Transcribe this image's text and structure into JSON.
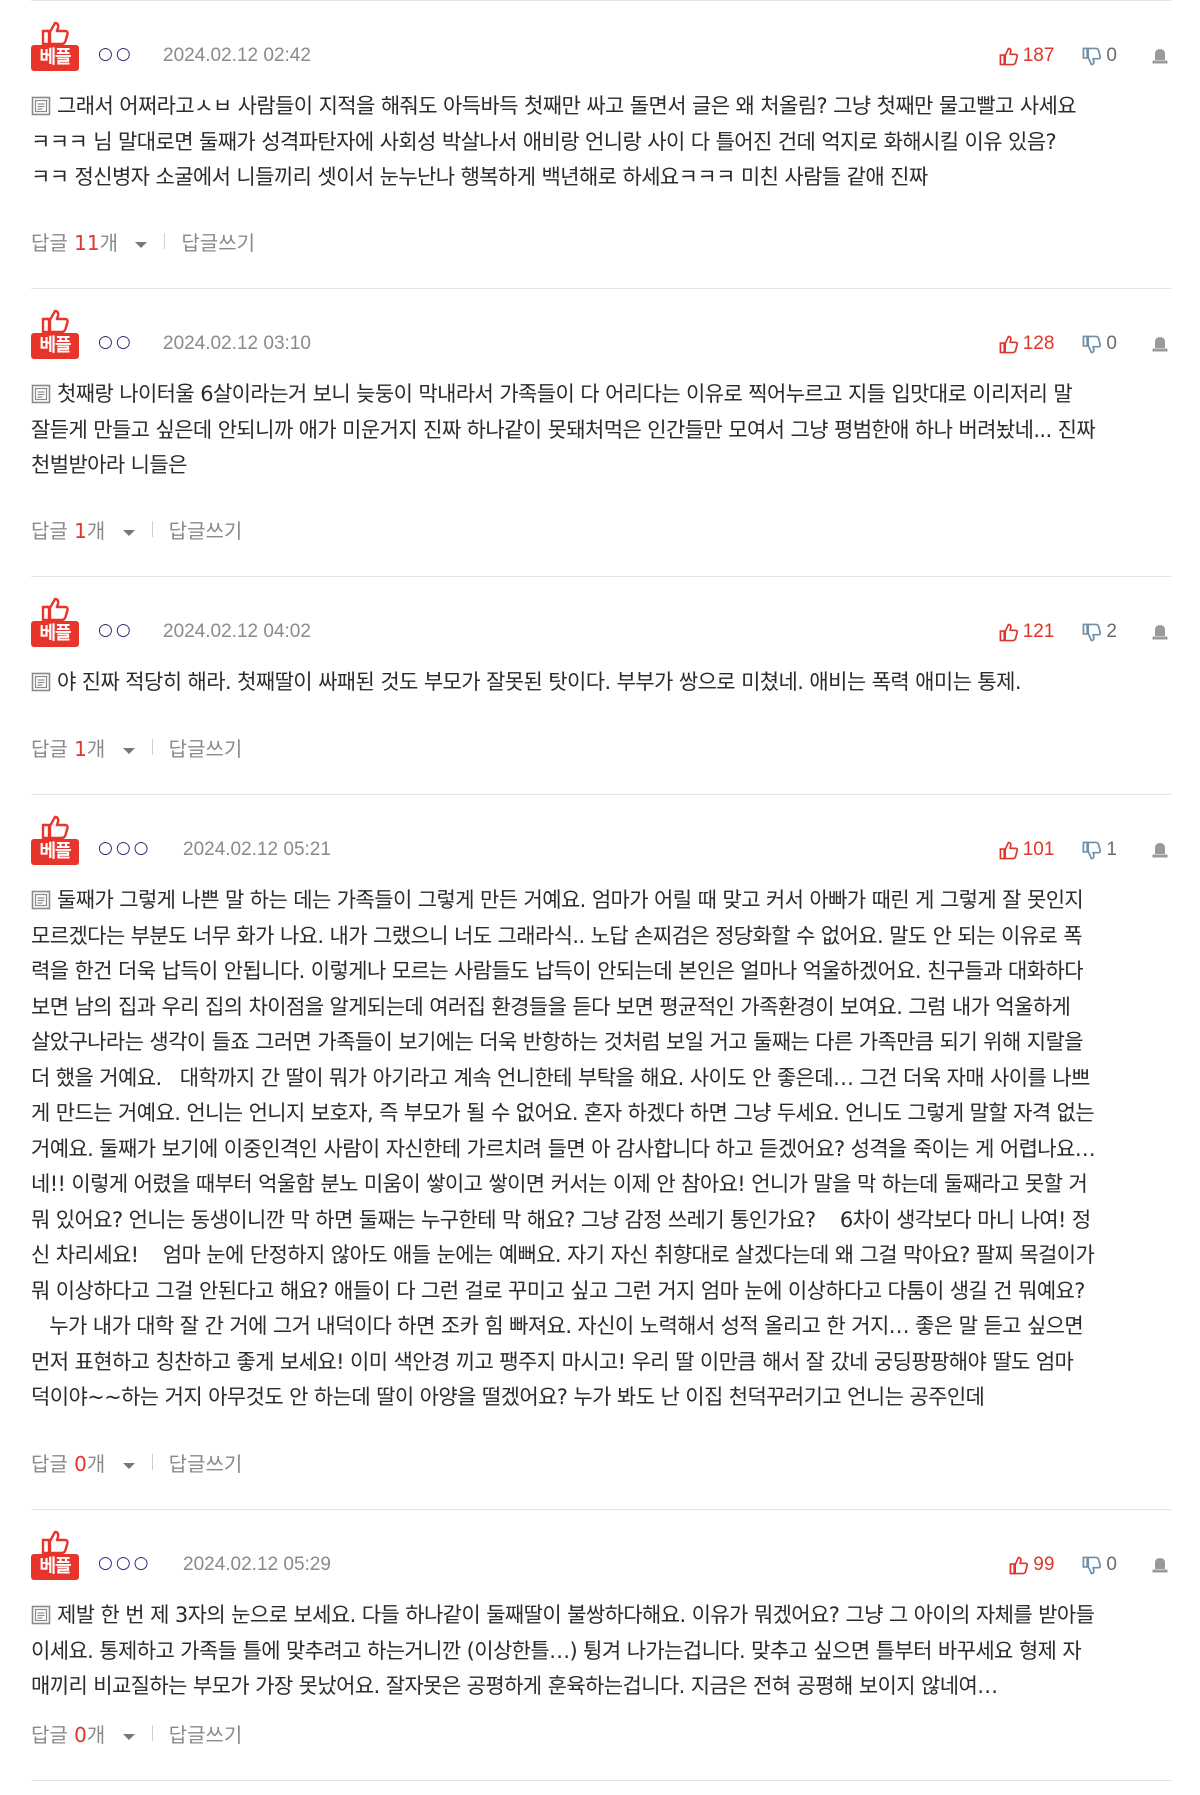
{
  "best_badge_label": "베플",
  "footer_reply_label": "답글",
  "footer_reply_unit": "개",
  "footer_write_label": "답글쓰기",
  "colors": {
    "accent_red": "#e0352b",
    "badge_red": "#e8352b",
    "meta_gray": "#8a8a8a",
    "nickname_blue": "#2a2a7a",
    "divider": "#e3e3e3"
  },
  "icons": {
    "badge": "thumbs-up-icon",
    "upvote": "thumbs-up-icon",
    "downvote": "thumbs-down-icon",
    "report": "report-icon",
    "body": "document-icon",
    "toggle": "caret-down-icon"
  },
  "comments": [
    {
      "nickname": "○○",
      "timestamp": "2024.02.12 02:42",
      "upvotes": "187",
      "downvotes": "0",
      "lines": [
        "그래서 어쩌라고ㅅㅂ 사람들이 지적을 해줘도 아득바득 첫째만 싸고 돌면서 글은 왜 처올림? 그냥 첫째만 물고빨고 사세요",
        "ㅋㅋㅋ 님 말대로면 둘째가 성격파탄자에 사회성 박살나서 애비랑 언니랑 사이 다 틀어진 건데 억지로 화해시킬 이유 있음?",
        "ㅋㅋ 정신병자 소굴에서 니들끼리 셋이서 눈누난나 행복하게 백년해로 하세요ㅋㅋㅋ 미친 사람들 같애 진짜"
      ],
      "reply_count": "11"
    },
    {
      "nickname": "○○",
      "timestamp": "2024.02.12 03:10",
      "upvotes": "128",
      "downvotes": "0",
      "lines": [
        "첫째랑 나이터울 6살이라는거 보니 늦둥이 막내라서 가족들이 다 어리다는 이유로 찍어누르고 지들 입맛대로 이리저리 말",
        "잘듣게 만들고 싶은데 안되니까 애가 미운거지 진짜 하나같이 못돼처먹은 인간들만 모여서 그냥 평범한애 하나 버려놨네... 진짜",
        "천벌받아라 니들은"
      ],
      "reply_count": "1"
    },
    {
      "nickname": "○○",
      "timestamp": "2024.02.12 04:02",
      "upvotes": "121",
      "downvotes": "2",
      "lines": [
        "야 진짜 적당히 해라. 첫째딸이 싸패된 것도 부모가 잘못된 탓이다. 부부가 쌍으로 미쳤네. 애비는 폭력 애미는 통제."
      ],
      "reply_count": "1"
    },
    {
      "nickname": "○○○",
      "timestamp": "2024.02.12 05:21",
      "upvotes": "101",
      "downvotes": "1",
      "lines": [
        "둘째가 그렇게 나쁜 말 하는 데는 가족들이 그렇게 만든 거예요. 엄마가 어릴 때 맞고 커서 아빠가 때린 게 그렇게 잘 못인지",
        "모르겠다는 부분도 너무 화가 나요. 내가 그랬으니 너도 그래라식.. 노답 손찌검은 정당화할 수 없어요. 말도 안 되는 이유로 폭",
        "력을 한건 더욱 납득이 안됩니다. 이렇게나 모르는 사람들도 납득이 안되는데 본인은 얼마나 억울하겠어요. 친구들과 대화하다",
        "보면 남의 집과 우리 집의 차이점을 알게되는데 여러집 환경들을 듣다 보면 평균적인 가족환경이 보여요. 그럼 내가 억울하게",
        "살았구나라는 생각이 들죠 그러면 가족들이 보기에는 더욱 반항하는 것처럼 보일 거고 둘째는 다른 가족만큼 되기 위해 지랄을",
        "더 했을 거예요.   대학까지 간 딸이 뭐가 아기라고 계속 언니한테 부탁을 해요. 사이도 안 좋은데… 그건 더욱 자매 사이를 나쁘",
        "게 만드는 거예요. 언니는 언니지 보호자, 즉 부모가 될 수 없어요. 혼자 하겠다 하면 그냥 두세요. 언니도 그렇게 말할 자격 없는",
        "거예요. 둘째가 보기에 이중인격인 사람이 자신한테 가르치려 들면 아 감사합니다 하고 듣겠어요? 성격을 죽이는 게 어렵나요…",
        "네!! 이렇게 어렸을 때부터 억울함 분노 미움이 쌓이고 쌓이면 커서는 이제 안 참아요! 언니가 말을 막 하는데 둘째라고 못할 거",
        "뭐 있어요? 언니는 동생이니깐 막 하면 둘째는 누구한테 막 해요? 그냥 감정 쓰레기 통인가요?    6차이 생각보다 마니 나여! 정",
        "신 차리세요!    엄마 눈에 단정하지 않아도 애들 눈에는 예뻐요. 자기 자신 취향대로 살겠다는데 왜 그걸 막아요? 팔찌 목걸이가",
        "뭐 이상하다고 그걸 안된다고 해요? 애들이 다 그런 걸로 꾸미고 싶고 그런 거지 엄마 눈에 이상하다고 다툼이 생길 건 뭐예요?",
        "   누가 내가 대학 잘 간 거에 그거 내덕이다 하면 조카 힘 빠져요. 자신이 노력해서 성적 올리고 한 거지… 좋은 말 듣고 싶으면",
        "먼저 표현하고 칭찬하고 좋게 보세요! 이미 색안경 끼고 팽주지 마시고! 우리 딸 이만큼 해서 잘 갔네 궁딩팡팡해야 딸도 엄마",
        "덕이야~~하는 거지 아무것도 안 하는데 딸이 아양을 떨겠어요? 누가 봐도 난 이집 천덕꾸러기고 언니는 공주인데"
      ],
      "reply_count": "0"
    },
    {
      "nickname": "○○○",
      "timestamp": "2024.02.12 05:29",
      "upvotes": "99",
      "downvotes": "0",
      "lines": [
        "제발 한 번 제 3자의 눈으로 보세요. 다들 하나같이 둘째딸이 불쌍하다해요. 이유가 뭐겠어요? 그냥 그 아이의 자체를 받아들",
        "이세요. 통제하고 가족들 틀에 맞추려고 하는거니깐 (이상한틀…) 튕겨 나가는겁니다. 맞추고 싶으면 틀부터 바꾸세요 형제 자",
        "매끼리 비교질하는 부모가 가장 못났어요. 잘자못은 공평하게 훈육하는겁니다. 지금은 전혀 공평해 보이지 않네여…"
      ],
      "reply_count": "0"
    }
  ]
}
